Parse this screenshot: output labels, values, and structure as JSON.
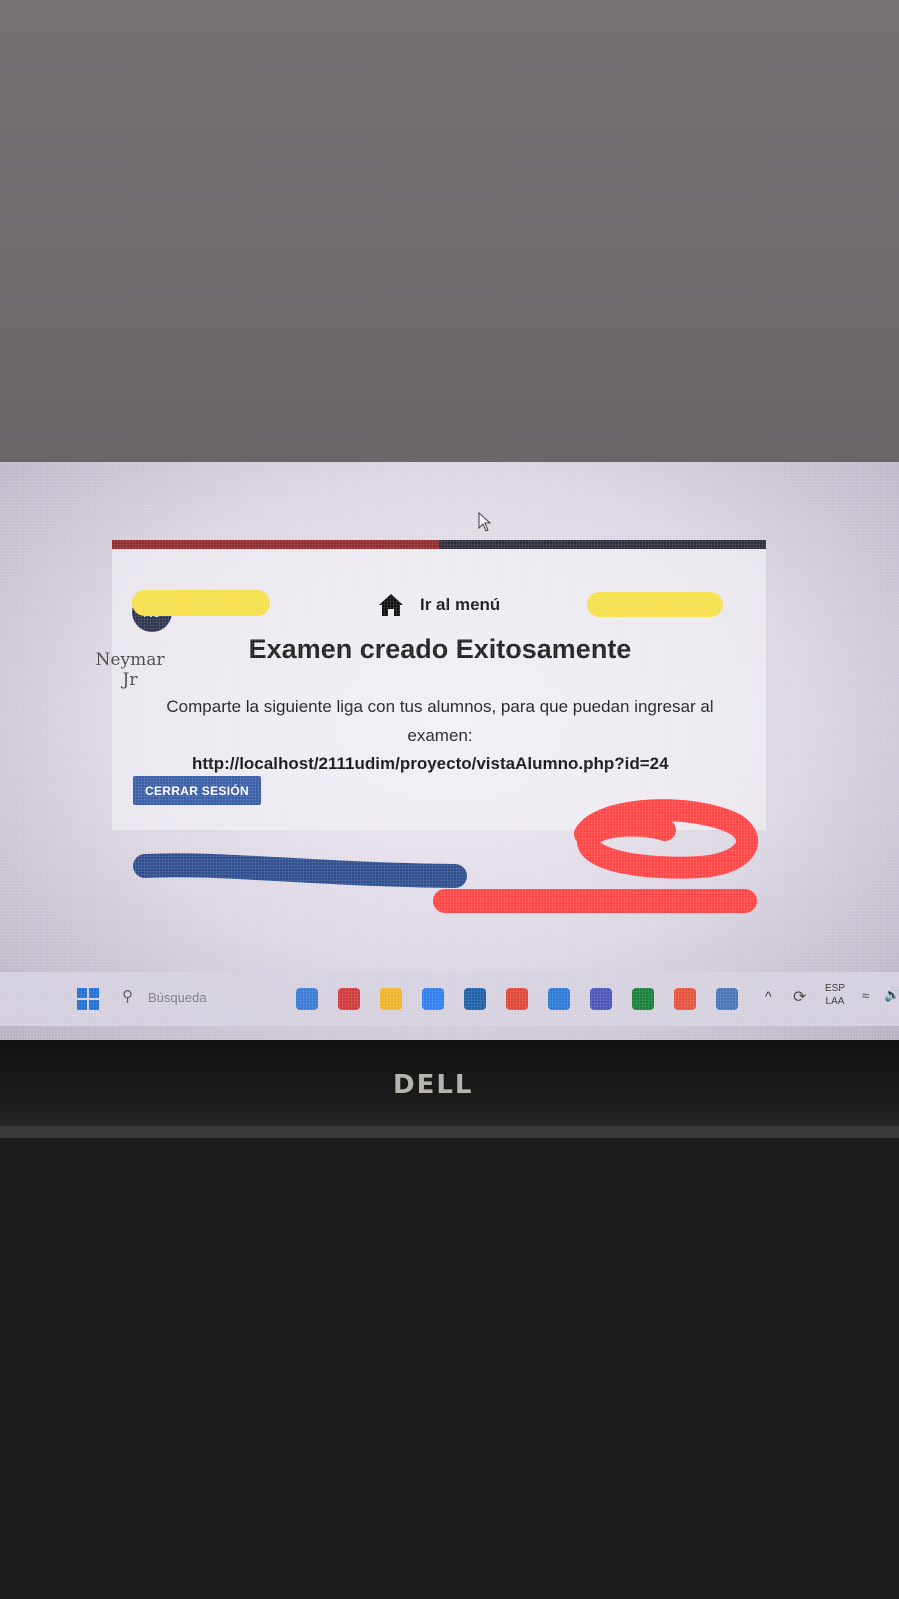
{
  "app": {
    "menu_link_label": "Ir al menú",
    "title": "Examen creado Exitosamente",
    "message": "Comparte la siguiente liga con tus alumnos, para que puedan ingresar al examen:",
    "exam_url": "http://localhost/2111udim/proyecto/vistaAlumno.php?id=24",
    "logout_label": "CERRAR SESIÓN"
  },
  "user": {
    "initials": "NJ",
    "name": "Neymar Jr"
  },
  "taskbar": {
    "search_placeholder": "Búsqueda",
    "language_line1": "ESP",
    "language_line2": "LAA",
    "apps": [
      {
        "icon": "files-app-icon",
        "color": "#3a7bd5"
      },
      {
        "icon": "opera-icon",
        "color": "#d03a3a"
      },
      {
        "icon": "file-explorer-icon",
        "color": "#f0b429"
      },
      {
        "icon": "photos-icon",
        "color": "#2f80ed"
      },
      {
        "icon": "store-icon",
        "color": "#1e5fa8"
      },
      {
        "icon": "chrome-icon",
        "color": "#e0463a"
      },
      {
        "icon": "vscode-icon",
        "color": "#2a7ad6"
      },
      {
        "icon": "teams-icon",
        "color": "#4b55b8"
      },
      {
        "icon": "xbox-icon",
        "color": "#1a7f3c"
      },
      {
        "icon": "xampp-icon",
        "color": "#e5533d"
      },
      {
        "icon": "settings-icon",
        "color": "#4a74b8"
      }
    ]
  },
  "colors": {
    "accent_blue": "#3b5ea9",
    "header_red": "#8e2b2f",
    "header_dark": "#2c2e3a",
    "redaction_yellow": "#f6e04a",
    "scribble_red": "#ff4545",
    "scribble_blue": "#2e4e8f"
  },
  "hardware": {
    "brand_logo": "DELL"
  }
}
